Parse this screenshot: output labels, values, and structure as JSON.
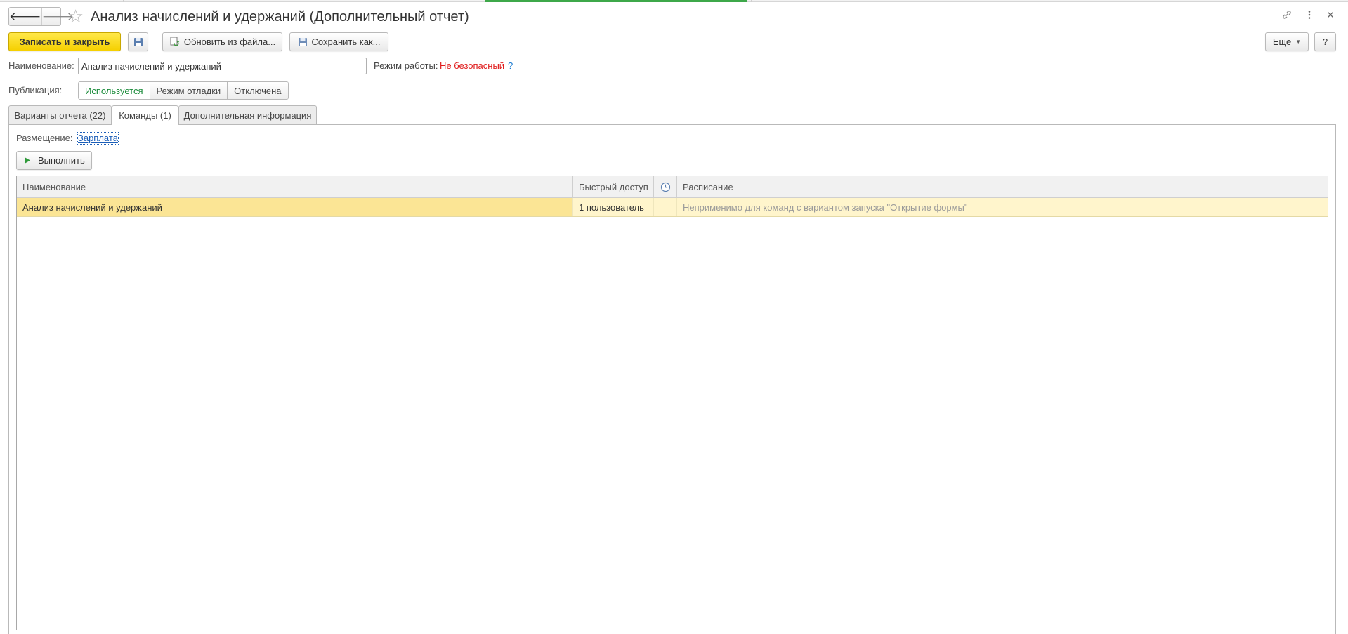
{
  "window": {
    "title": "Анализ начислений и удержаний (Дополнительный отчет)",
    "accent_color": "#3ea84a",
    "icons": {
      "back": "arrow-left-icon",
      "forward": "arrow-right-icon",
      "favorite": "star-icon",
      "link": "link-icon",
      "more": "kebab-menu-icon",
      "close": "close-icon"
    }
  },
  "toolbar": {
    "save_close_label": "Записать и закрыть",
    "save_icon": "floppy-disk-icon",
    "update_from_file_label": "Обновить из файла...",
    "save_as_label": "Сохранить как...",
    "more_label": "Еще",
    "help_label": "?"
  },
  "form": {
    "name_label": "Наименование:",
    "name_value": "Анализ начислений и удержаний",
    "mode_label": "Режим работы:",
    "mode_value": "Не безопасный",
    "mode_value_color": "#e01b1b",
    "mode_help": "?",
    "publication_label": "Публикация:",
    "publication_options": [
      "Используется",
      "Режим отладки",
      "Отключена"
    ],
    "publication_selected": "Используется"
  },
  "tabs": [
    {
      "label": "Варианты отчета (22)"
    },
    {
      "label": "Команды (1)",
      "active": true
    },
    {
      "label": "Дополнительная информация"
    }
  ],
  "commands": {
    "placement_label": "Размещение:",
    "placement_value": "Зарплата",
    "run_label": "Выполнить",
    "table": {
      "columns": [
        "Наименование",
        "Быстрый доступ",
        "",
        "Расписание"
      ],
      "schedule_icon": "clock-icon",
      "rows": [
        {
          "name": "Анализ начислений и удержаний",
          "quick_access": "1 пользователь",
          "flag": "",
          "schedule": "Неприменимо для команд с вариантом запуска \"Открытие формы\""
        }
      ]
    }
  }
}
